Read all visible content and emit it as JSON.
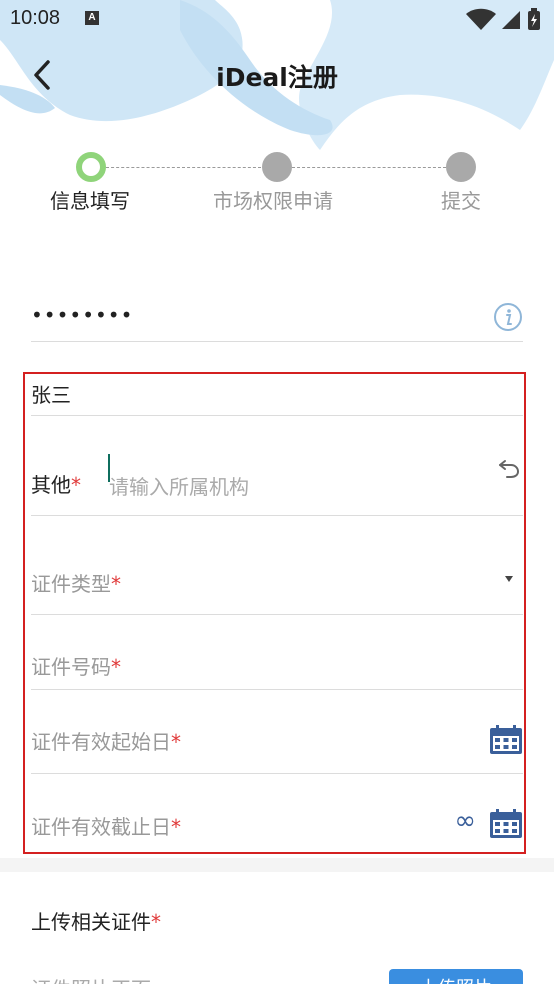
{
  "status_bar": {
    "time": "10:08",
    "notif_letter": "A"
  },
  "header": {
    "title": "iDeal注册"
  },
  "steps": [
    {
      "label": "信息填写",
      "active": true
    },
    {
      "label": "市场权限申请",
      "active": false
    },
    {
      "label": "提交",
      "active": false
    }
  ],
  "password": {
    "value": "••••••••"
  },
  "form": {
    "name_value": "张三",
    "other_label": "其他",
    "other_placeholder": "请输入所属机构",
    "id_type_label": "证件类型",
    "id_number_label": "证件号码",
    "start_date_label": "证件有效起始日",
    "end_date_label": "证件有效截止日",
    "required_mark": "*",
    "infinity_symbol": "∞"
  },
  "upload": {
    "title": "上传相关证件",
    "sub_label": "证件照片正面",
    "button_label": "上传照片"
  },
  "colors": {
    "accent": "#3a8ee0",
    "required": "#e03a3a",
    "active_step": "#8fd47a",
    "highlight_border": "#d42020"
  }
}
